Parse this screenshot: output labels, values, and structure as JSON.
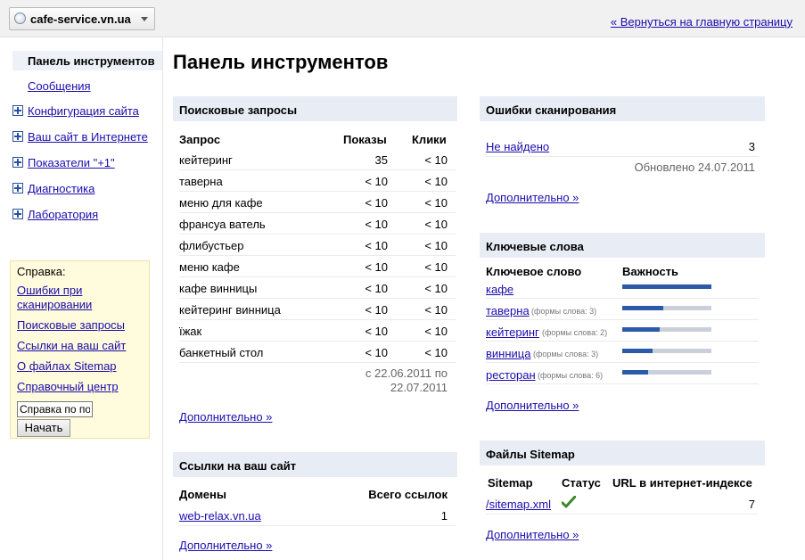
{
  "header": {
    "site_name": "cafe-service.vn.ua",
    "back_link": "« Вернуться на главную страницу"
  },
  "nav": {
    "items": [
      {
        "label": "Панель инструментов"
      },
      {
        "label": "Сообщения"
      },
      {
        "label": "Конфигурация сайта"
      },
      {
        "label": "Ваш сайт в Интернете"
      },
      {
        "label": "Показатели \"+1\""
      },
      {
        "label": "Диагностика"
      },
      {
        "label": "Лаборатория"
      }
    ]
  },
  "help": {
    "title": "Справка:",
    "links": [
      "Ошибки при сканировании",
      "Поисковые запросы",
      "Ссылки на ваш сайт",
      "О файлах Sitemap",
      "Справочный центр"
    ],
    "search_value": "Справка по по",
    "button": "Начать"
  },
  "page_title": "Панель инструментов",
  "queries": {
    "title": "Поисковые запросы",
    "col_query": "Запрос",
    "col_impr": "Показы",
    "col_clicks": "Клики",
    "rows": [
      {
        "q": "кейтеринг",
        "impr": "35",
        "clicks": "< 10"
      },
      {
        "q": "таверна",
        "impr": "< 10",
        "clicks": "< 10"
      },
      {
        "q": "меню для кафе",
        "impr": "< 10",
        "clicks": "< 10"
      },
      {
        "q": "франсуа ватель",
        "impr": "< 10",
        "clicks": "< 10"
      },
      {
        "q": "флибустьер",
        "impr": "< 10",
        "clicks": "< 10"
      },
      {
        "q": "меню кафе",
        "impr": "< 10",
        "clicks": "< 10"
      },
      {
        "q": "кафе винницы",
        "impr": "< 10",
        "clicks": "< 10"
      },
      {
        "q": "кейтеринг винница",
        "impr": "< 10",
        "clicks": "< 10"
      },
      {
        "q": "їжак",
        "impr": "< 10",
        "clicks": "< 10"
      },
      {
        "q": "банкетный стол",
        "impr": "< 10",
        "clicks": "< 10"
      }
    ],
    "date_line1": "с 22.06.2011 по",
    "date_line2": "22.07.2011",
    "more": "Дополнительно »"
  },
  "links_panel": {
    "title": "Ссылки на ваш сайт",
    "col_domains": "Домены",
    "col_total": "Всего ссылок",
    "rows": [
      {
        "domain": "web-relax.vn.ua",
        "count": "1"
      }
    ],
    "more": "Дополнительно »"
  },
  "crawl": {
    "title": "Ошибки сканирования",
    "not_found": "Не найдено",
    "count": "3",
    "updated": "Обновлено 24.07.2011",
    "more": "Дополнительно »"
  },
  "keywords": {
    "title": "Ключевые слова",
    "col_keyword": "Ключевое слово",
    "col_importance": "Важность",
    "rows": [
      {
        "word": "кафе",
        "forms": "",
        "importance": 1.0
      },
      {
        "word": "таверна",
        "forms": "(формы слова: 3)",
        "importance": 0.46
      },
      {
        "word": "кейтеринг",
        "forms": "(формы слова: 2)",
        "importance": 0.42
      },
      {
        "word": "винница",
        "forms": "(формы слова: 3)",
        "importance": 0.34
      },
      {
        "word": "ресторан",
        "forms": "(формы слова: 6)",
        "importance": 0.29
      }
    ],
    "more": "Дополнительно »"
  },
  "sitemaps": {
    "title": "Файлы Sitemap",
    "col_sitemap": "Sitemap",
    "col_status": "Статус",
    "col_urls": "URL в интернет-индексе",
    "rows": [
      {
        "file": "/sitemap.xml",
        "status_icon": "check-icon",
        "urls": "7"
      }
    ],
    "more": "Дополнительно »"
  }
}
